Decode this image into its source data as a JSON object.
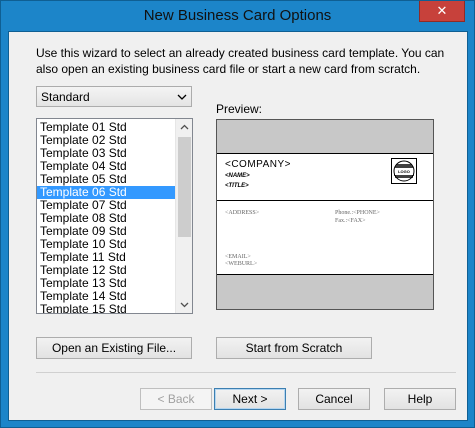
{
  "window": {
    "title": "New Business Card Options",
    "close_glyph": "✕"
  },
  "intro_text": "Use this wizard to select an already created business card template.  You can also open an existing business card file or start a new card from scratch.",
  "dropdown": {
    "selected": "Standard"
  },
  "template_list": {
    "selected_index": 5,
    "items": [
      "Template 01 Std",
      "Template 02 Std",
      "Template 03 Std",
      "Template 04 Std",
      "Template 05 Std",
      "Template 06 Std",
      "Template 07 Std",
      "Template 08 Std",
      "Template 09 Std",
      "Template 10 Std",
      "Template 11 Std",
      "Template 12 Std",
      "Template 13 Std",
      "Template 14 Std",
      "Template 15 Std"
    ]
  },
  "preview": {
    "label": "Preview:",
    "company": "<COMPANY>",
    "name": "<NAME>",
    "title": "<TITLE>",
    "logo": "LOGO",
    "address": "<ADDRESS>",
    "phone": "Phone.:<PHONE>",
    "fax": "Fax.:<FAX>",
    "email": "<EMAIL>",
    "web": "<WEBURL>"
  },
  "buttons": {
    "open_existing": "Open an Existing File...",
    "start_scratch": "Start from Scratch",
    "back": "< Back",
    "next": "Next >",
    "cancel": "Cancel",
    "help": "Help"
  },
  "colors": {
    "title_bar": "#1c85c9",
    "selection": "#3399ff",
    "close_button": "#c7413b"
  }
}
